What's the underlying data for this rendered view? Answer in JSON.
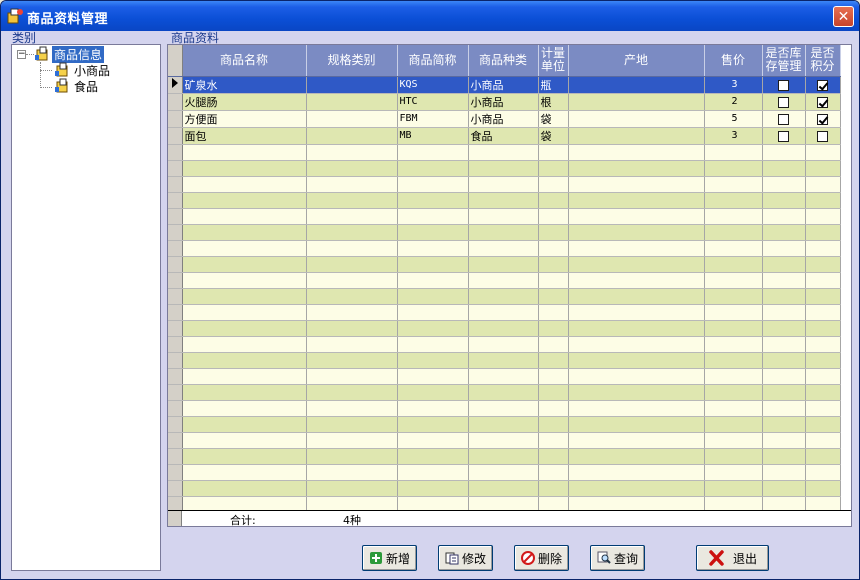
{
  "window": {
    "title": "商品资料管理"
  },
  "tree": {
    "section_label": "类别",
    "root": {
      "label": "商品信息",
      "expander": "−"
    },
    "children": [
      {
        "label": "小商品"
      },
      {
        "label": "食品"
      }
    ]
  },
  "grid": {
    "section_label": "商品资料",
    "columns": [
      {
        "label": "商品名称"
      },
      {
        "label": "规格类别"
      },
      {
        "label": "商品简称"
      },
      {
        "label": "商品种类"
      },
      {
        "label": "计量单位"
      },
      {
        "label": "产地"
      },
      {
        "label": "售价"
      },
      {
        "label": "是否库存管理"
      },
      {
        "label": "是否积分"
      }
    ],
    "rows": [
      {
        "name": "矿泉水",
        "spec": "",
        "short": "KQS",
        "kind": "小商品",
        "unit": "瓶",
        "origin": "",
        "price": "3",
        "stock": false,
        "points": true,
        "selected": true
      },
      {
        "name": "火腿肠",
        "spec": "",
        "short": "HTC",
        "kind": "小商品",
        "unit": "根",
        "origin": "",
        "price": "2",
        "stock": false,
        "points": true,
        "selected": false
      },
      {
        "name": "方便面",
        "spec": "",
        "short": "FBM",
        "kind": "小商品",
        "unit": "袋",
        "origin": "",
        "price": "5",
        "stock": false,
        "points": true,
        "selected": false
      },
      {
        "name": "面包",
        "spec": "",
        "short": "MB",
        "kind": "食品",
        "unit": "袋",
        "origin": "",
        "price": "3",
        "stock": false,
        "points": false,
        "selected": false
      }
    ],
    "empty_rows": 24,
    "footer": {
      "label": "合计:",
      "value": "4种"
    }
  },
  "buttons": {
    "add": "新增",
    "edit": "修改",
    "delete": "删除",
    "query": "查询",
    "exit": "退出"
  },
  "colors": {
    "titlebar": "#0b4fd6",
    "header": "#7b8bc3",
    "row_odd": "#fdfde6",
    "row_even": "#dfe7b0",
    "selection": "#2f59c6"
  }
}
